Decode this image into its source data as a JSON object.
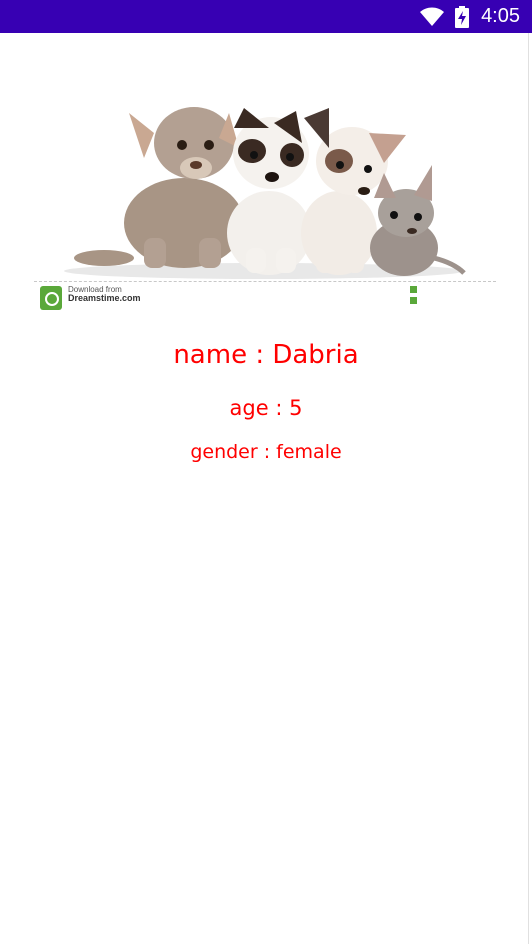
{
  "status_bar": {
    "time": "4:05",
    "background": "#3700b3",
    "icons": [
      "wifi-icon",
      "battery-charging-icon"
    ]
  },
  "photo": {
    "description_icon": "puppies-photo",
    "credit": {
      "line1": "Download from",
      "line2": "Dreamstime.com"
    }
  },
  "details": {
    "name": "name : Dabria",
    "age": "age : 5",
    "gender": "gender : female",
    "color": "#ff0000"
  }
}
